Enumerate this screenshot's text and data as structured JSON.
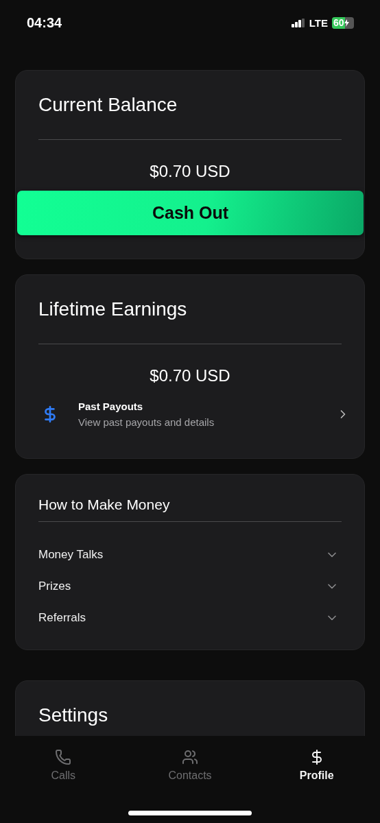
{
  "status_bar": {
    "time": "04:34",
    "network": "LTE",
    "battery": "60",
    "charging": true
  },
  "balance_card": {
    "title": "Current Balance",
    "amount": "$0.70 USD",
    "button": "Cash Out"
  },
  "earnings_card": {
    "title": "Lifetime Earnings",
    "amount": "$0.70 USD",
    "row": {
      "title": "Past Payouts",
      "subtitle": "View past payouts and details"
    }
  },
  "money_card": {
    "title": "How to Make Money",
    "items": [
      {
        "label": "Money Talks",
        "expanded": false
      },
      {
        "label": "Prizes",
        "expanded": false
      },
      {
        "label": "Referrals",
        "expanded": false
      }
    ]
  },
  "settings_card": {
    "title": "Settings"
  },
  "tab_bar": [
    {
      "label": "Calls",
      "selected": false
    },
    {
      "label": "Contacts",
      "selected": false
    },
    {
      "label": "Profile",
      "selected": true
    }
  ]
}
